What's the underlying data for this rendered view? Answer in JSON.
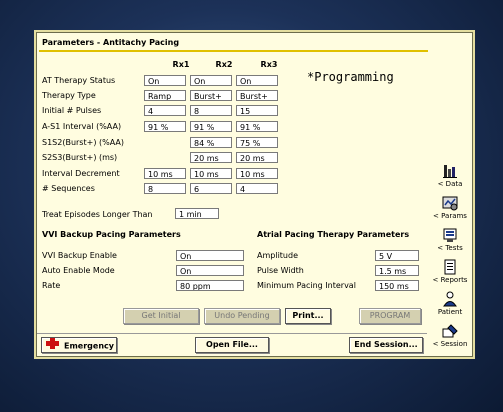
{
  "window": {
    "title": "Parameters - Antitachy Pacing",
    "status": "*Programming"
  },
  "table": {
    "columns": [
      "Rx1",
      "Rx2",
      "Rx3"
    ],
    "rows": [
      {
        "label": "AT Therapy Status",
        "values": [
          "On",
          "On",
          "On"
        ]
      },
      {
        "label": "Therapy Type",
        "values": [
          "Ramp",
          "Burst+",
          "Burst+"
        ]
      },
      {
        "label": "Initial # Pulses",
        "values": [
          "4",
          "8",
          "15"
        ]
      },
      {
        "label": "A-S1 Interval (%AA)",
        "values": [
          "91 %",
          "91 %",
          "91 %"
        ]
      },
      {
        "label": "S1S2(Burst+) (%AA)",
        "values": [
          "",
          "84 %",
          "75 %"
        ]
      },
      {
        "label": "S2S3(Burst+) (ms)",
        "values": [
          "",
          "20 ms",
          "20 ms"
        ]
      },
      {
        "label": "Interval Decrement",
        "values": [
          "10 ms",
          "10 ms",
          "10 ms"
        ]
      },
      {
        "label": "# Sequences",
        "values": [
          "8",
          "6",
          "4"
        ]
      }
    ]
  },
  "treat": {
    "label": "Treat Episodes Longer Than",
    "value": "1 min"
  },
  "vvi": {
    "title": "VVI Backup Pacing Parameters",
    "rows": [
      {
        "label": "VVI Backup Enable",
        "value": "On"
      },
      {
        "label": "Auto Enable Mode",
        "value": "On"
      },
      {
        "label": "Rate",
        "value": "80 ppm"
      }
    ]
  },
  "atrial": {
    "title": "Atrial Pacing Therapy Parameters",
    "rows": [
      {
        "label": "Amplitude",
        "value": "5 V"
      },
      {
        "label": "Pulse Width",
        "value": "1.5 ms"
      },
      {
        "label": "Minimum Pacing Interval",
        "value": "150 ms"
      }
    ]
  },
  "buttons": {
    "get_initial": "Get Initial",
    "undo_pending": "Undo Pending",
    "print": "Print...",
    "program": "PROGRAM",
    "emergency": "Emergency",
    "open_file": "Open File...",
    "end_session": "End Session..."
  },
  "sidebar": [
    {
      "icon": "data-icon",
      "label": "< Data"
    },
    {
      "icon": "params-icon",
      "label": "< Params"
    },
    {
      "icon": "tests-icon",
      "label": "< Tests"
    },
    {
      "icon": "reports-icon",
      "label": "< Reports"
    },
    {
      "icon": "patient-icon",
      "label": "Patient"
    },
    {
      "icon": "session-icon",
      "label": "< Session"
    }
  ],
  "colors": {
    "panel": "#fffde0",
    "accent": "#e0c000",
    "emergency": "#cc1111"
  }
}
